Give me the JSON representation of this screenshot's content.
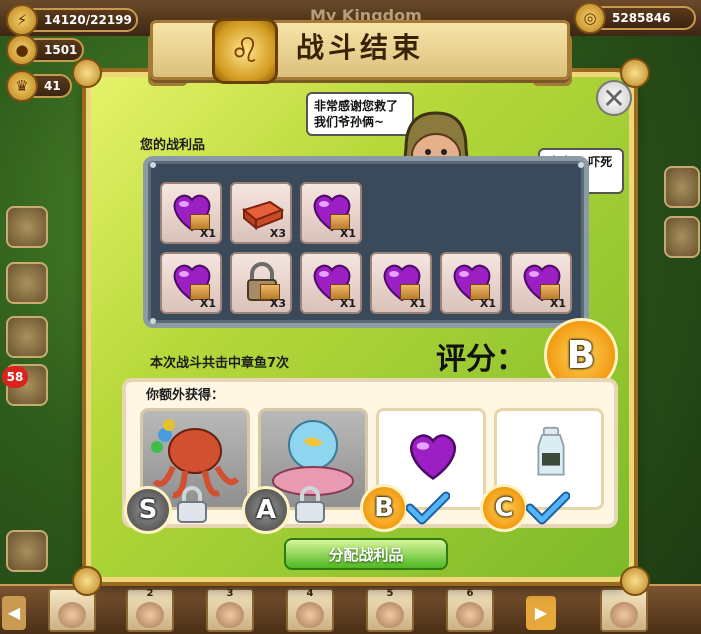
{
  "hud": {
    "energy": "14120/22199",
    "coins": "1501",
    "level": "41",
    "gold": "5285846",
    "kingdom_title": "My Kingdom",
    "left_badge": "58"
  },
  "dialog": {
    "title": "战斗结束",
    "close_glyph": "✕",
    "loot_label": "您的战利品",
    "bubble_left": "非常感谢您救了我们爷孙俩~",
    "bubble_right": "呜呜....吓死我了~~",
    "hits_text": "本次战斗共击中章鱼7次",
    "score_label": "评分：",
    "score_grade": "B",
    "extra_label": "你额外获得：",
    "distribute_button": "分配战利品"
  },
  "loot_items": [
    {
      "icon": "purple-heart-crate",
      "qty": "X1"
    },
    {
      "icon": "red-brick",
      "qty": "X3"
    },
    {
      "icon": "purple-heart-crate",
      "qty": "X1"
    },
    {
      "icon": "purple-heart-crate",
      "qty": "X1"
    },
    {
      "icon": "padlock-crate",
      "qty": "X3"
    },
    {
      "icon": "purple-heart-crate",
      "qty": "X1"
    },
    {
      "icon": "purple-heart-crate",
      "qty": "X1"
    },
    {
      "icon": "purple-heart-crate",
      "qty": "X1"
    },
    {
      "icon": "purple-heart-crate",
      "qty": "X1"
    }
  ],
  "rewards": [
    {
      "grade": "S",
      "state": "locked",
      "icon": "octopus-ship"
    },
    {
      "grade": "A",
      "state": "locked",
      "icon": "aquarium-ship"
    },
    {
      "grade": "B",
      "state": "earned",
      "icon": "purple-heart"
    },
    {
      "grade": "C",
      "state": "earned",
      "icon": "milk-bottle"
    }
  ],
  "friends": [
    "2",
    "3",
    "4",
    "5",
    "6"
  ],
  "colors": {
    "dialog_green": "#b6d83a",
    "score_burst": "#f29b12",
    "check_blue": "#2f8fe0",
    "button_green": "#4fb822"
  }
}
